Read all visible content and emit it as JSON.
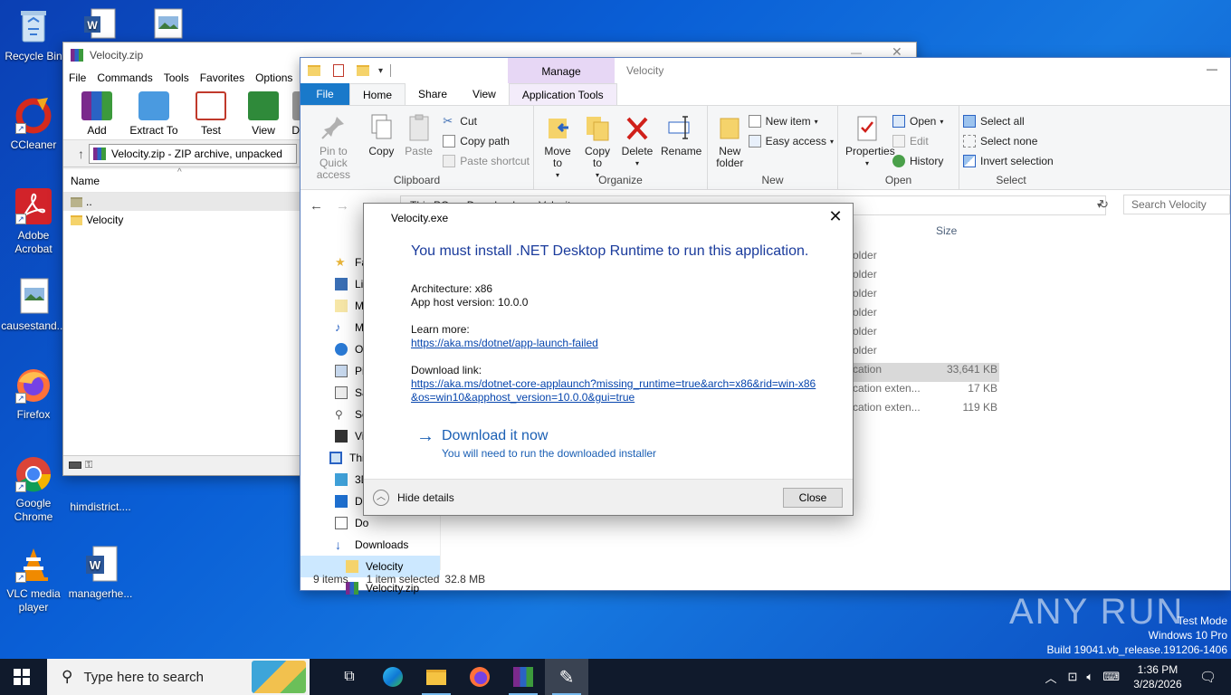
{
  "desktop": {
    "icons": [
      {
        "label": "Recycle Bin"
      },
      {
        "label": "CCleaner"
      },
      {
        "label": "Adobe Acrobat"
      },
      {
        "label": "causestand..."
      },
      {
        "label": "Firefox"
      },
      {
        "label": "Google Chrome"
      },
      {
        "label": "himdistrict...."
      },
      {
        "label": "VLC media player"
      },
      {
        "label": "managerhe..."
      }
    ]
  },
  "winrar": {
    "title": "Velocity.zip",
    "menu": [
      "File",
      "Commands",
      "Tools",
      "Favorites",
      "Options"
    ],
    "toolbar": [
      "Add",
      "Extract To",
      "Test",
      "View",
      "De"
    ],
    "address": "Velocity.zip - ZIP archive, unpacked",
    "column_name": "Name",
    "rows": [
      "..",
      "Velocity"
    ]
  },
  "explorer": {
    "title": "Velocity",
    "context_tab": "Manage",
    "tabs": [
      "File",
      "Home",
      "Share",
      "View",
      "Application Tools"
    ],
    "ribbon": {
      "clipboard": {
        "pin": "Pin to Quick access",
        "copy": "Copy",
        "paste": "Paste",
        "cut": "Cut",
        "copy_path": "Copy path",
        "paste_shortcut": "Paste shortcut",
        "label": "Clipboard"
      },
      "organize": {
        "move_to": "Move to",
        "copy_to": "Copy to",
        "delete": "Delete",
        "rename": "Rename",
        "label": "Organize"
      },
      "new": {
        "new_folder": "New folder",
        "new_item": "New item",
        "easy_access": "Easy access",
        "label": "New"
      },
      "open": {
        "properties": "Properties",
        "open": "Open",
        "edit": "Edit",
        "history": "History",
        "label": "Open"
      },
      "select": {
        "select_all": "Select all",
        "select_none": "Select none",
        "invert": "Invert selection",
        "label": "Select"
      }
    },
    "breadcrumb": [
      "This PC",
      "Downloads",
      "Velocity"
    ],
    "search_placeholder": "Search Velocity",
    "column_size": "Size",
    "nav": [
      "Fa",
      "Li",
      "M",
      "M",
      "O",
      "Pi",
      "Sa",
      "Se",
      "Vi",
      "Thi",
      "3D",
      "De",
      "Do",
      "Downloads",
      "Velocity",
      "Velocity.zip"
    ],
    "files": [
      {
        "type": "older",
        "size": ""
      },
      {
        "type": "older",
        "size": ""
      },
      {
        "type": "older",
        "size": ""
      },
      {
        "type": "older",
        "size": ""
      },
      {
        "type": "older",
        "size": ""
      },
      {
        "type": "older",
        "size": ""
      },
      {
        "type": "cation",
        "size": "33,641 KB"
      },
      {
        "type": "cation exten...",
        "size": "17 KB"
      },
      {
        "type": "cation exten...",
        "size": "119 KB"
      }
    ],
    "status": {
      "items": "9 items",
      "selected": "1 item selected",
      "size": "32.8 MB"
    }
  },
  "dialog": {
    "title": "Velocity.exe",
    "heading": "You must install .NET Desktop Runtime to run this application.",
    "arch": "Architecture: x86",
    "apphost": "App host version: 10.0.0",
    "learn_more_label": "Learn more:",
    "learn_more_url": "https://aka.ms/dotnet/app-launch-failed",
    "download_label": "Download link:",
    "download_url": "https://aka.ms/dotnet-core-applaunch?missing_runtime=true&arch=x86&rid=win-x86&os=win10&apphost_version=10.0.0&gui=true",
    "download_now": "Download it now",
    "download_sub": "You will need to run the downloaded installer",
    "hide_details": "Hide details",
    "close": "Close"
  },
  "taskbar": {
    "search_placeholder": "Type here to search",
    "time": "1:36 PM",
    "date": "3/28/2026"
  },
  "watermark": {
    "brand": "ANY RUN",
    "line1": "Test Mode",
    "line2": "Windows 10 Pro",
    "line3": "Build 19041.vb_release.191206-1406"
  }
}
